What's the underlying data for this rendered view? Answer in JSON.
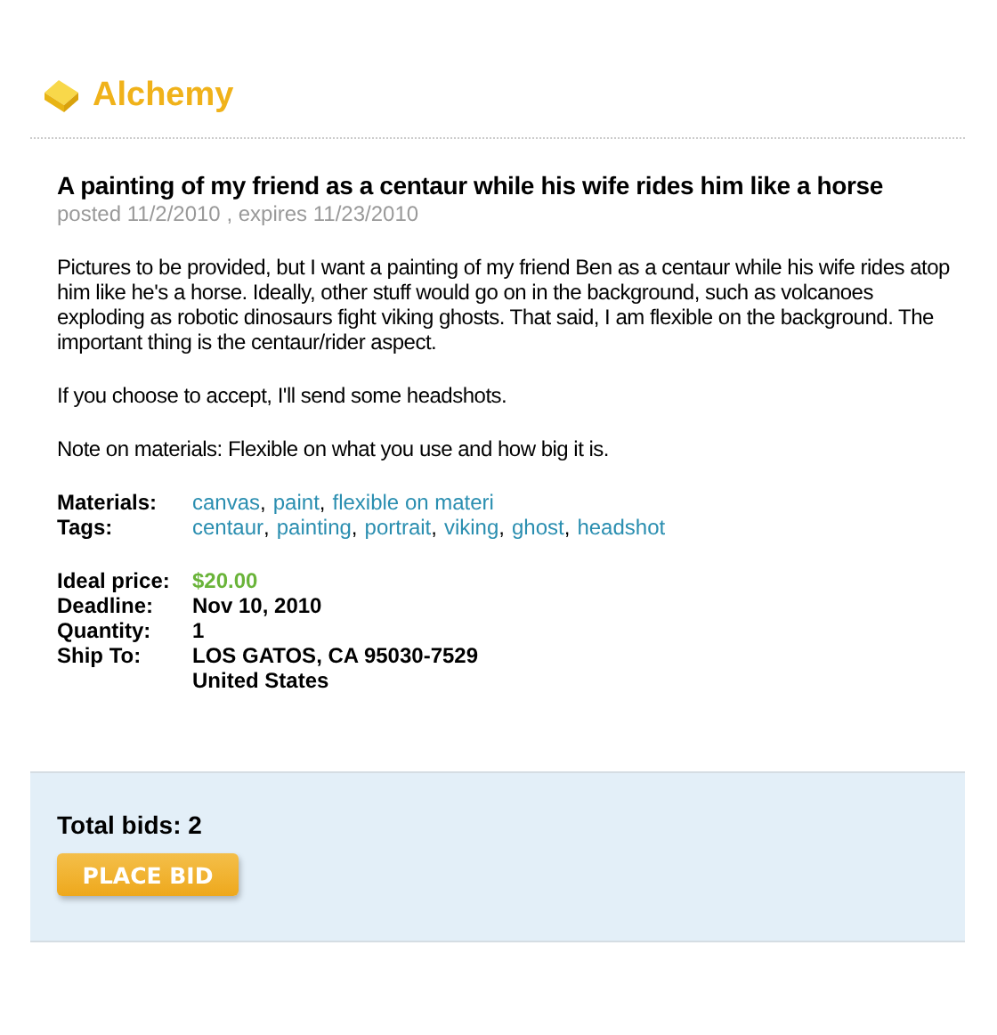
{
  "brand": {
    "name": "Alchemy"
  },
  "request": {
    "title": "A painting of my friend as a centaur while his wife rides him like a horse",
    "posted": "posted 11/2/2010",
    "expires": ", expires 11/23/2010",
    "paragraphs": [
      "Pictures to be provided, but I want a painting of my friend Ben as a centaur while his wife rides atop him like he's a horse. Ideally, other stuff would go on in the background, such as volcanoes exploding as robotic dinosaurs fight viking ghosts. That said, I am flexible on the background. The important thing is the centaur/rider aspect.",
      "If you choose to accept, I'll send some headshots.",
      "Note on materials: Flexible on what you use and how big it is."
    ],
    "link_lists": [
      {
        "label": "Materials:",
        "separator": ",",
        "items": [
          "canvas",
          "paint",
          "flexible on materi"
        ]
      },
      {
        "label": "Tags:",
        "separator": ",",
        "items": [
          "centaur",
          "painting",
          "portrait",
          "viking",
          "ghost",
          "headshot"
        ]
      }
    ],
    "details": [
      {
        "label": "Ideal price:",
        "kind": "price",
        "lines": [
          "$20.00"
        ]
      },
      {
        "label": "Deadline:",
        "kind": "plain",
        "lines": [
          "Nov 10, 2010"
        ]
      },
      {
        "label": "Quantity:",
        "kind": "plain",
        "lines": [
          "1"
        ]
      },
      {
        "label": "Ship To:",
        "kind": "plain",
        "lines": [
          "LOS GATOS, CA 95030-7529",
          "United States"
        ]
      }
    ]
  },
  "bids": {
    "total": "Total bids: 2",
    "button": "PLACE BID"
  }
}
